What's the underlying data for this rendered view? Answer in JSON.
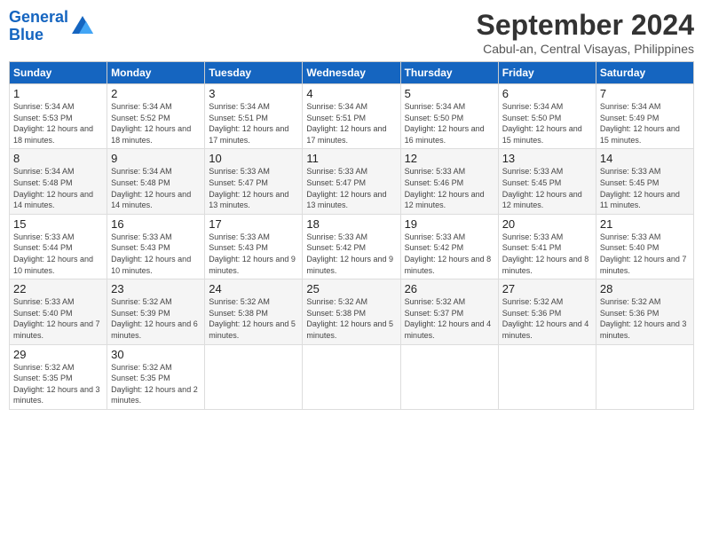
{
  "header": {
    "logo_line1": "General",
    "logo_line2": "Blue",
    "month": "September 2024",
    "location": "Cabul-an, Central Visayas, Philippines"
  },
  "weekdays": [
    "Sunday",
    "Monday",
    "Tuesday",
    "Wednesday",
    "Thursday",
    "Friday",
    "Saturday"
  ],
  "weeks": [
    [
      {
        "day": "1",
        "rise": "5:34 AM",
        "set": "5:53 PM",
        "daylight": "12 hours and 18 minutes."
      },
      {
        "day": "2",
        "rise": "5:34 AM",
        "set": "5:52 PM",
        "daylight": "12 hours and 18 minutes."
      },
      {
        "day": "3",
        "rise": "5:34 AM",
        "set": "5:51 PM",
        "daylight": "12 hours and 17 minutes."
      },
      {
        "day": "4",
        "rise": "5:34 AM",
        "set": "5:51 PM",
        "daylight": "12 hours and 17 minutes."
      },
      {
        "day": "5",
        "rise": "5:34 AM",
        "set": "5:50 PM",
        "daylight": "12 hours and 16 minutes."
      },
      {
        "day": "6",
        "rise": "5:34 AM",
        "set": "5:50 PM",
        "daylight": "12 hours and 15 minutes."
      },
      {
        "day": "7",
        "rise": "5:34 AM",
        "set": "5:49 PM",
        "daylight": "12 hours and 15 minutes."
      }
    ],
    [
      {
        "day": "8",
        "rise": "5:34 AM",
        "set": "5:48 PM",
        "daylight": "12 hours and 14 minutes."
      },
      {
        "day": "9",
        "rise": "5:34 AM",
        "set": "5:48 PM",
        "daylight": "12 hours and 14 minutes."
      },
      {
        "day": "10",
        "rise": "5:33 AM",
        "set": "5:47 PM",
        "daylight": "12 hours and 13 minutes."
      },
      {
        "day": "11",
        "rise": "5:33 AM",
        "set": "5:47 PM",
        "daylight": "12 hours and 13 minutes."
      },
      {
        "day": "12",
        "rise": "5:33 AM",
        "set": "5:46 PM",
        "daylight": "12 hours and 12 minutes."
      },
      {
        "day": "13",
        "rise": "5:33 AM",
        "set": "5:45 PM",
        "daylight": "12 hours and 12 minutes."
      },
      {
        "day": "14",
        "rise": "5:33 AM",
        "set": "5:45 PM",
        "daylight": "12 hours and 11 minutes."
      }
    ],
    [
      {
        "day": "15",
        "rise": "5:33 AM",
        "set": "5:44 PM",
        "daylight": "12 hours and 10 minutes."
      },
      {
        "day": "16",
        "rise": "5:33 AM",
        "set": "5:43 PM",
        "daylight": "12 hours and 10 minutes."
      },
      {
        "day": "17",
        "rise": "5:33 AM",
        "set": "5:43 PM",
        "daylight": "12 hours and 9 minutes."
      },
      {
        "day": "18",
        "rise": "5:33 AM",
        "set": "5:42 PM",
        "daylight": "12 hours and 9 minutes."
      },
      {
        "day": "19",
        "rise": "5:33 AM",
        "set": "5:42 PM",
        "daylight": "12 hours and 8 minutes."
      },
      {
        "day": "20",
        "rise": "5:33 AM",
        "set": "5:41 PM",
        "daylight": "12 hours and 8 minutes."
      },
      {
        "day": "21",
        "rise": "5:33 AM",
        "set": "5:40 PM",
        "daylight": "12 hours and 7 minutes."
      }
    ],
    [
      {
        "day": "22",
        "rise": "5:33 AM",
        "set": "5:40 PM",
        "daylight": "12 hours and 7 minutes."
      },
      {
        "day": "23",
        "rise": "5:32 AM",
        "set": "5:39 PM",
        "daylight": "12 hours and 6 minutes."
      },
      {
        "day": "24",
        "rise": "5:32 AM",
        "set": "5:38 PM",
        "daylight": "12 hours and 5 minutes."
      },
      {
        "day": "25",
        "rise": "5:32 AM",
        "set": "5:38 PM",
        "daylight": "12 hours and 5 minutes."
      },
      {
        "day": "26",
        "rise": "5:32 AM",
        "set": "5:37 PM",
        "daylight": "12 hours and 4 minutes."
      },
      {
        "day": "27",
        "rise": "5:32 AM",
        "set": "5:36 PM",
        "daylight": "12 hours and 4 minutes."
      },
      {
        "day": "28",
        "rise": "5:32 AM",
        "set": "5:36 PM",
        "daylight": "12 hours and 3 minutes."
      }
    ],
    [
      {
        "day": "29",
        "rise": "5:32 AM",
        "set": "5:35 PM",
        "daylight": "12 hours and 3 minutes."
      },
      {
        "day": "30",
        "rise": "5:32 AM",
        "set": "5:35 PM",
        "daylight": "12 hours and 2 minutes."
      },
      null,
      null,
      null,
      null,
      null
    ]
  ]
}
